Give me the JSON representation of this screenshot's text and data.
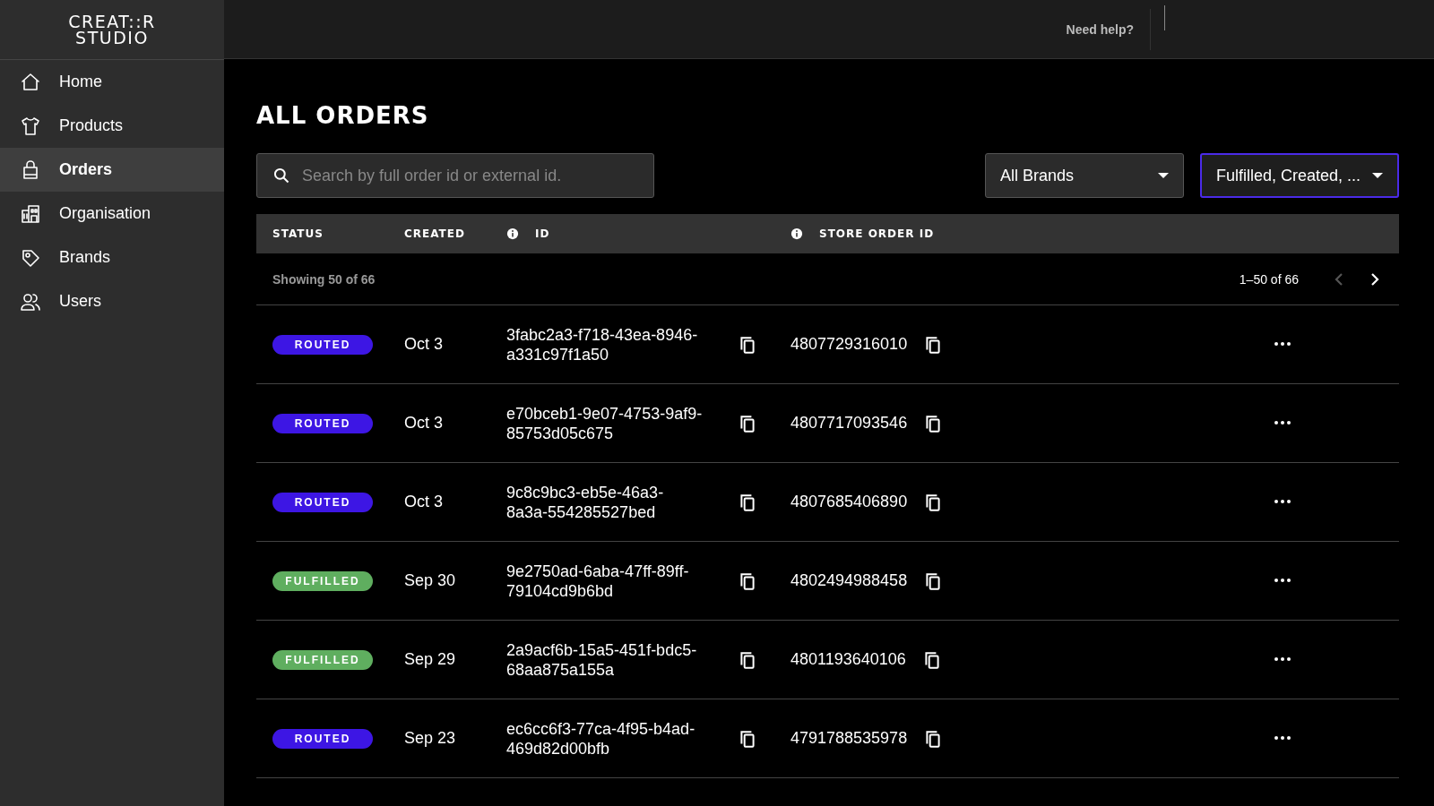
{
  "logo": {
    "lines": [
      "CREAT::R",
      "STUDIO"
    ]
  },
  "sidebar": {
    "items": [
      {
        "label": "Home",
        "selected": false
      },
      {
        "label": "Products",
        "selected": false
      },
      {
        "label": "Orders",
        "selected": true
      },
      {
        "label": "Organisation",
        "selected": false
      },
      {
        "label": "Brands",
        "selected": false
      },
      {
        "label": "Users",
        "selected": false
      }
    ]
  },
  "topbar": {
    "help": "Need help?"
  },
  "page": {
    "title": "ALL ORDERS"
  },
  "search": {
    "placeholder": "Search by full order id or external id."
  },
  "filters": [
    {
      "value": "All Brands",
      "focused": false
    },
    {
      "value": "Fulfilled, Created, ...",
      "focused": true
    }
  ],
  "table": {
    "columns": [
      {
        "label": "STATUS",
        "info": false
      },
      {
        "label": "CREATED",
        "info": false
      },
      {
        "label": "ID",
        "info": true
      },
      {
        "label": "STORE ORDER ID",
        "info": true
      }
    ],
    "summary": "Showing 50 of 66",
    "range": "1–50 of 66",
    "prev_disabled": true,
    "next_disabled": false,
    "rows": [
      {
        "status": "ROUTED",
        "kind": "routed",
        "created": "Oct 3",
        "id": [
          "3fabc2a3-f718-43ea-8946-",
          "a331c97f1a50"
        ],
        "store_order_id": "4807729316010"
      },
      {
        "status": "ROUTED",
        "kind": "routed",
        "created": "Oct 3",
        "id": [
          "e70bceb1-9e07-4753-9af9-",
          "85753d05c675"
        ],
        "store_order_id": "4807717093546"
      },
      {
        "status": "ROUTED",
        "kind": "routed",
        "created": "Oct 3",
        "id": [
          "9c8c9bc3-eb5e-46a3-",
          "8a3a-554285527bed"
        ],
        "store_order_id": "4807685406890"
      },
      {
        "status": "FULFILLED",
        "kind": "fulfilled",
        "created": "Sep 30",
        "id": [
          "9e2750ad-6aba-47ff-89ff-",
          "79104cd9b6bd"
        ],
        "store_order_id": "4802494988458"
      },
      {
        "status": "FULFILLED",
        "kind": "fulfilled",
        "created": "Sep 29",
        "id": [
          "2a9acf6b-15a5-451f-bdc5-",
          "68aa875a155a"
        ],
        "store_order_id": "4801193640106"
      },
      {
        "status": "ROUTED",
        "kind": "routed",
        "created": "Sep 23",
        "id": [
          "ec6cc6f3-77ca-4f95-b4ad-",
          "469d82d00bfb"
        ],
        "store_order_id": "4791788535978"
      }
    ]
  }
}
